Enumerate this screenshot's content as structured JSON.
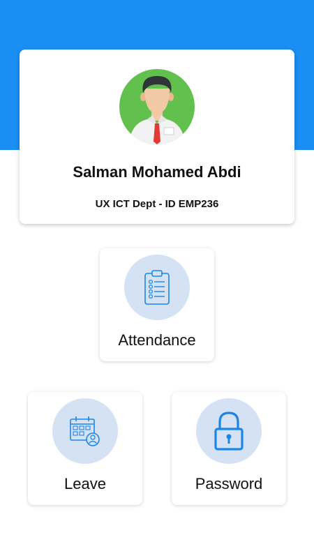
{
  "header": {
    "accent_color": "#1a8ef3"
  },
  "profile": {
    "name": "Salman Mohamed Abdi",
    "dept_line": "UX ICT Dept - ID EMP236",
    "avatar_icon": "employee-avatar"
  },
  "menu": {
    "attendance": {
      "label": "Attendance",
      "icon": "clipboard-checklist-icon"
    },
    "leave": {
      "label": "Leave",
      "icon": "calendar-user-icon"
    },
    "password": {
      "label": "Password",
      "icon": "padlock-icon"
    }
  }
}
